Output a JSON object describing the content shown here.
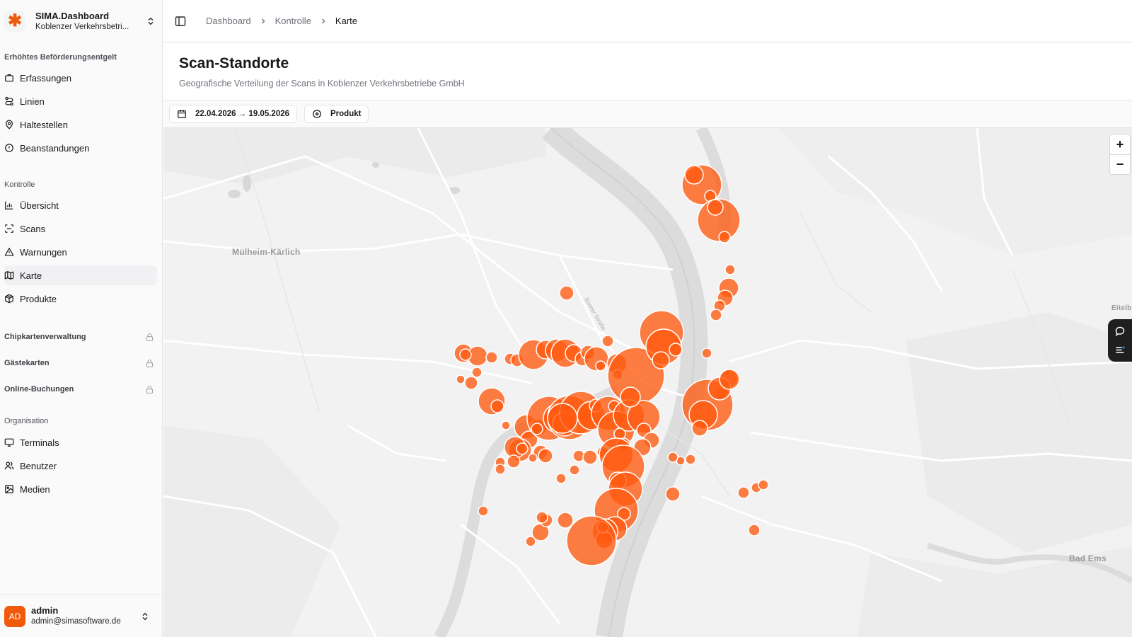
{
  "brand": {
    "name": "SIMA.Dashboard",
    "org": "Koblenzer Verkehrsbetri..."
  },
  "sidebar": {
    "section1": "Erhöhtes Beförderungsentgelt",
    "section1_items": [
      {
        "label": "Erfassungen",
        "icon": "briefcase-icon"
      },
      {
        "label": "Linien",
        "icon": "route-icon"
      },
      {
        "label": "Haltestellen",
        "icon": "map-pin-icon"
      },
      {
        "label": "Beanstandungen",
        "icon": "alert-circle-icon"
      }
    ],
    "section2": "Kontrolle",
    "section2_items": [
      {
        "label": "Übersicht",
        "icon": "bar-chart-icon"
      },
      {
        "label": "Scans",
        "icon": "scan-icon"
      },
      {
        "label": "Warnungen",
        "icon": "warning-triangle-icon"
      },
      {
        "label": "Karte",
        "icon": "map-icon",
        "active": true
      },
      {
        "label": "Produkte",
        "icon": "package-icon"
      }
    ],
    "locked": [
      "Chipkartenverwaltung",
      "Gästekarten",
      "Online-Buchungen"
    ],
    "section3": "Organisation",
    "section3_items": [
      {
        "label": "Terminals",
        "icon": "monitor-icon"
      },
      {
        "label": "Benutzer",
        "icon": "users-icon"
      },
      {
        "label": "Medien",
        "icon": "image-icon"
      }
    ]
  },
  "user": {
    "initials": "AD",
    "name": "admin",
    "email": "admin@simasoftware.de"
  },
  "breadcrumb": [
    "Dashboard",
    "Kontrolle",
    "Karte"
  ],
  "page": {
    "title": "Scan-Standorte",
    "subtitle": "Geografische Verteilung der Scans in Koblenzer Verkehrsbetriebe GmbH"
  },
  "filters": {
    "date_range": "22.04.2026 → 19.05.2026",
    "product_label": "Produkt"
  },
  "map": {
    "places": [
      "Mülheim-Kärlich",
      "Bad Ems",
      "Eitelb",
      "Bonner Straße"
    ],
    "zoom_in": "+",
    "zoom_out": "−",
    "marker_color": "#ff5a0f"
  }
}
